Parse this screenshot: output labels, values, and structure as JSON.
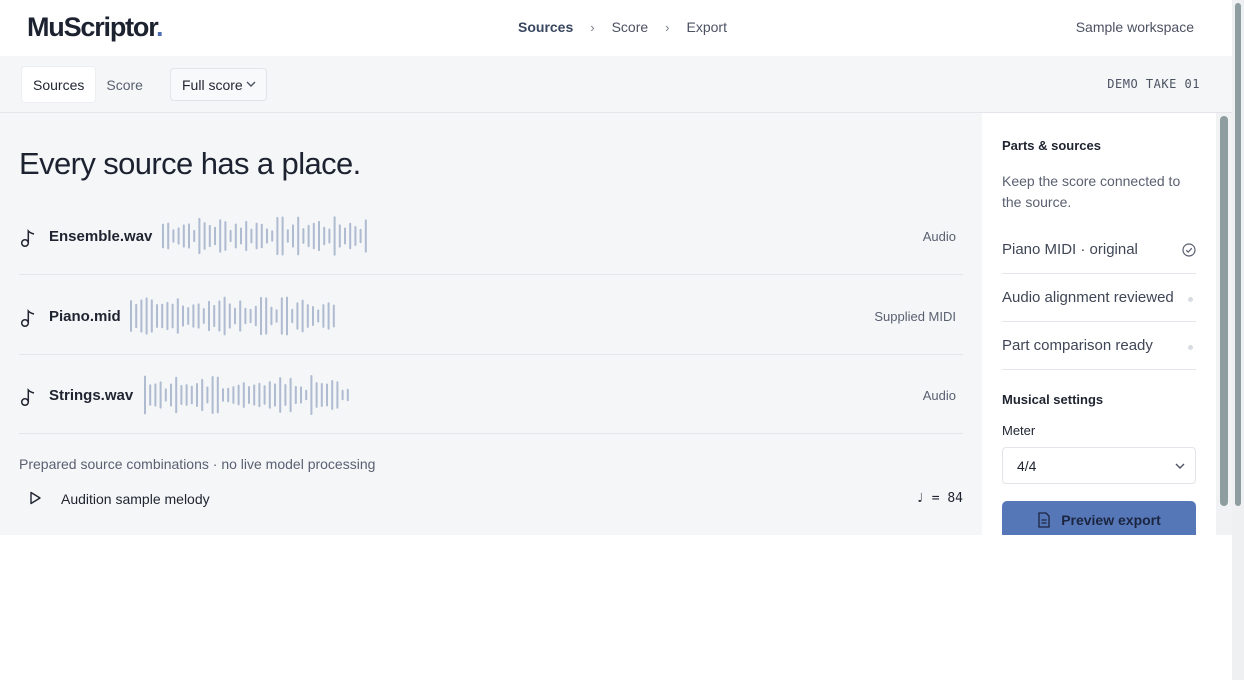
{
  "brand": {
    "name": "MuScriptor",
    "dot": "."
  },
  "breadcrumb": [
    "Sources",
    "Score",
    "Export"
  ],
  "workspace": "Sample workspace",
  "toolbar": {
    "tabs": [
      "Sources",
      "Score"
    ],
    "score_select": "Full score",
    "take_label": "DEMO TAKE 01"
  },
  "main": {
    "headline": "Every source has a place.",
    "sources": [
      {
        "name": "Ensemble.wav",
        "kind": "Audio"
      },
      {
        "name": "Piano.mid",
        "kind": "Supplied MIDI"
      },
      {
        "name": "Strings.wav",
        "kind": "Audio"
      }
    ],
    "prepared_note": "Prepared source combinations · no live model processing",
    "audition_label": "Audition sample melody",
    "tempo": {
      "symbol": "♩",
      "equals": "=",
      "bpm": "84"
    }
  },
  "panel": {
    "parts_heading": "Parts & sources",
    "description": "Keep the score connected to the source.",
    "items": [
      {
        "label": "Piano MIDI · original",
        "state": "checked"
      },
      {
        "label": "Audio alignment reviewed",
        "state": "pending"
      },
      {
        "label": "Part comparison ready",
        "state": "pending"
      }
    ],
    "settings_heading": "Musical settings",
    "meter_label": "Meter",
    "meter_value": "4/4",
    "preview_button": "Preview export"
  },
  "colors": {
    "accent": "#5577b8",
    "wave": "#aebbd1",
    "panel_bg": "#f4f6f8"
  },
  "icons": [
    "music-note-icon",
    "chevron-down-icon",
    "chevron-right-icon",
    "play-icon",
    "check-circle-icon",
    "document-icon"
  ]
}
